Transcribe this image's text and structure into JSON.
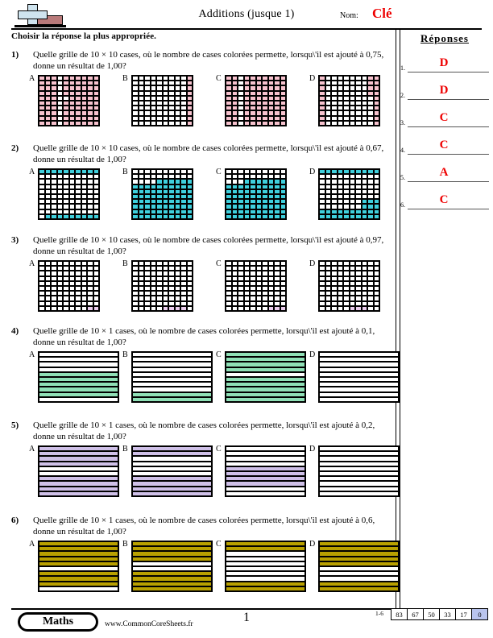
{
  "header": {
    "title": "Additions (jusque 1)",
    "name_label": "Nom:",
    "name_value": "Clé",
    "instruction": "Choisir la réponse la plus appropriée.",
    "logo_icon": "plus-block-logo"
  },
  "answers": {
    "title": "Réponses",
    "items": [
      {
        "num": "1.",
        "value": "D"
      },
      {
        "num": "2.",
        "value": "D"
      },
      {
        "num": "3.",
        "value": "C"
      },
      {
        "num": "4.",
        "value": "C"
      },
      {
        "num": "5.",
        "value": "A"
      },
      {
        "num": "6.",
        "value": "C"
      }
    ]
  },
  "questions": [
    {
      "num": "1)",
      "text": "Quelle grille de 10 × 10 cases, où le nombre de cases colorées permette, lorsqu\\'il est ajouté à 0,75, donne un résultat de 1,00?",
      "grid_type": "10x10",
      "color": "#f7c2ce",
      "choices": [
        {
          "label": "A",
          "filled": 75
        },
        {
          "label": "B",
          "filled": 10
        },
        {
          "label": "C",
          "filled": 80
        },
        {
          "label": "D",
          "filled": 25
        }
      ]
    },
    {
      "num": "2)",
      "text": "Quelle grille de 10 × 10 cases, où le nombre de cases colorées permette, lorsqu\\'il est ajouté à 0,67, donne un résultat de 1,00?",
      "grid_type": "10x10",
      "color": "#3fd0dd",
      "choices": [
        {
          "label": "A",
          "filled": 21
        },
        {
          "label": "B",
          "filled": 65
        },
        {
          "label": "C",
          "filled": 73
        },
        {
          "label": "D",
          "filled": 33
        }
      ]
    },
    {
      "num": "3)",
      "text": "Quelle grille de 10 × 10 cases, où le nombre de cases colorées permette, lorsqu\\'il est ajouté à 0,97, donne un résultat de 1,00?",
      "grid_type": "10x10",
      "color": "#eccdef",
      "choices": [
        {
          "label": "A",
          "filled": 2
        },
        {
          "label": "B",
          "filled": 4
        },
        {
          "label": "C",
          "filled": 3
        },
        {
          "label": "D",
          "filled": 3
        }
      ]
    },
    {
      "num": "4)",
      "text": "Quelle grille de 10 × 1 cases, où le nombre de cases colorées permette, lorsqu\\'il est ajouté à 0,1, donne un résultat de 1,00?",
      "grid_type": "10x1",
      "color": "#8fe0b6",
      "choices": [
        {
          "label": "A",
          "filled": 5
        },
        {
          "label": "B",
          "filled": 2
        },
        {
          "label": "C",
          "filled": 9
        },
        {
          "label": "D",
          "filled": 0
        }
      ]
    },
    {
      "num": "5)",
      "text": "Quelle grille de 10 × 1 cases, où le nombre de cases colorées permette, lorsqu\\'il est ajouté à 0,2, donne un résultat de 1,00?",
      "grid_type": "10x1",
      "color": "#cfc0e8",
      "choices": [
        {
          "label": "A",
          "filled": 8
        },
        {
          "label": "B",
          "filled": 6
        },
        {
          "label": "C",
          "filled": 4
        },
        {
          "label": "D",
          "filled": 0
        }
      ]
    },
    {
      "num": "6)",
      "text": "Quelle grille de 10 × 1 cases, où le nombre de cases colorées permette, lorsqu\\'il est ajouté à 0,6, donne un résultat de 1,00?",
      "grid_type": "10x1",
      "color": "#b8a000",
      "choices": [
        {
          "label": "A",
          "filled": 7
        },
        {
          "label": "B",
          "filled": 8
        },
        {
          "label": "C",
          "filled": 4
        },
        {
          "label": "D",
          "filled": 6
        }
      ]
    }
  ],
  "fill_patterns": {
    "q1": {
      "A": [
        1,
        1,
        1,
        0,
        1,
        1,
        1,
        1,
        1,
        1,
        1,
        1,
        1,
        0,
        1,
        1,
        1,
        1,
        1,
        1,
        1,
        1,
        1,
        0,
        1,
        1,
        1,
        1,
        1,
        1,
        1,
        1,
        1,
        0,
        1,
        1,
        1,
        1,
        1,
        1,
        1,
        1,
        1,
        0,
        0,
        1,
        1,
        1,
        1,
        1,
        1,
        1,
        1,
        0,
        1,
        1,
        1,
        1,
        1,
        1,
        1,
        1,
        1,
        0,
        1,
        1,
        1,
        1,
        1,
        1,
        1,
        1,
        1,
        0,
        1,
        1,
        1,
        1,
        1,
        1,
        1,
        1,
        1,
        0,
        1,
        1,
        1,
        1,
        1,
        1,
        1,
        1,
        1,
        0,
        1,
        1,
        1,
        1,
        1,
        1
      ],
      "B": [
        0,
        0,
        0,
        0,
        0,
        0,
        0,
        0,
        0,
        1,
        0,
        0,
        0,
        0,
        0,
        0,
        0,
        0,
        0,
        1,
        0,
        0,
        0,
        0,
        0,
        0,
        0,
        0,
        0,
        1,
        0,
        0,
        0,
        0,
        0,
        0,
        0,
        0,
        0,
        1,
        0,
        0,
        0,
        0,
        0,
        0,
        0,
        0,
        0,
        1,
        0,
        0,
        0,
        0,
        0,
        0,
        0,
        0,
        0,
        1,
        0,
        0,
        0,
        0,
        0,
        0,
        0,
        0,
        0,
        1,
        0,
        0,
        0,
        0,
        0,
        0,
        0,
        0,
        0,
        1,
        0,
        0,
        0,
        0,
        0,
        0,
        0,
        0,
        0,
        1,
        0,
        0,
        0,
        0,
        0,
        0,
        0,
        0,
        0,
        1
      ],
      "C": [
        1,
        1,
        0,
        1,
        1,
        1,
        1,
        1,
        1,
        1,
        1,
        1,
        0,
        1,
        1,
        1,
        1,
        1,
        1,
        1,
        1,
        1,
        0,
        1,
        1,
        1,
        1,
        1,
        1,
        1,
        1,
        1,
        0,
        1,
        1,
        1,
        1,
        1,
        1,
        1,
        1,
        1,
        0,
        1,
        1,
        1,
        1,
        1,
        1,
        1,
        1,
        1,
        0,
        1,
        1,
        1,
        1,
        1,
        1,
        1,
        1,
        1,
        0,
        1,
        1,
        1,
        1,
        1,
        1,
        1,
        1,
        1,
        0,
        1,
        1,
        1,
        1,
        1,
        1,
        1,
        1,
        1,
        0,
        1,
        1,
        1,
        1,
        1,
        1,
        1,
        1,
        1,
        0,
        1,
        1,
        1,
        1,
        1,
        1,
        1
      ],
      "D": [
        1,
        0,
        0,
        0,
        0,
        0,
        0,
        0,
        1,
        1,
        1,
        0,
        0,
        0,
        0,
        0,
        0,
        0,
        1,
        1,
        1,
        0,
        0,
        0,
        0,
        0,
        0,
        0,
        1,
        1,
        1,
        0,
        0,
        0,
        0,
        0,
        0,
        0,
        1,
        1,
        1,
        0,
        0,
        0,
        0,
        0,
        0,
        0,
        0,
        1,
        1,
        0,
        0,
        0,
        0,
        0,
        0,
        0,
        0,
        1,
        1,
        0,
        0,
        0,
        0,
        0,
        0,
        0,
        0,
        1,
        1,
        0,
        0,
        0,
        0,
        0,
        0,
        0,
        0,
        1,
        1,
        0,
        0,
        0,
        0,
        0,
        0,
        0,
        0,
        1,
        1,
        0,
        0,
        0,
        0,
        0,
        0,
        0,
        0,
        1
      ]
    },
    "q2": {
      "A": [
        1,
        1,
        1,
        1,
        1,
        1,
        1,
        1,
        1,
        1,
        0,
        0,
        0,
        0,
        0,
        0,
        0,
        0,
        0,
        0,
        0,
        0,
        0,
        0,
        0,
        0,
        0,
        0,
        0,
        0,
        0,
        0,
        0,
        0,
        0,
        0,
        0,
        0,
        0,
        0,
        0,
        0,
        0,
        0,
        0,
        0,
        0,
        0,
        0,
        0,
        0,
        0,
        0,
        0,
        0,
        0,
        0,
        0,
        0,
        0,
        0,
        0,
        0,
        0,
        0,
        0,
        0,
        0,
        0,
        0,
        0,
        0,
        0,
        0,
        0,
        0,
        0,
        0,
        0,
        0,
        0,
        0,
        0,
        0,
        0,
        0,
        0,
        0,
        0,
        0,
        0,
        1,
        1,
        1,
        1,
        1,
        1,
        1,
        1,
        1
      ],
      "B": [
        0,
        0,
        0,
        0,
        0,
        0,
        0,
        0,
        0,
        0,
        0,
        0,
        0,
        0,
        0,
        0,
        0,
        0,
        0,
        0,
        0,
        0,
        0,
        0,
        1,
        1,
        1,
        1,
        1,
        1,
        1,
        1,
        1,
        1,
        1,
        1,
        1,
        1,
        1,
        1,
        1,
        1,
        1,
        1,
        1,
        1,
        1,
        1,
        1,
        1,
        1,
        1,
        1,
        1,
        1,
        1,
        1,
        1,
        1,
        1,
        1,
        1,
        1,
        1,
        1,
        1,
        1,
        1,
        1,
        1,
        1,
        1,
        1,
        1,
        1,
        1,
        1,
        1,
        1,
        1,
        1,
        1,
        1,
        1,
        1,
        1,
        1,
        1,
        1,
        1,
        1,
        1,
        1,
        1,
        1,
        1,
        1,
        1,
        1,
        1
      ],
      "C": [
        0,
        0,
        0,
        0,
        0,
        0,
        0,
        0,
        0,
        0,
        0,
        0,
        0,
        0,
        0,
        0,
        0,
        0,
        0,
        0,
        0,
        0,
        0,
        1,
        1,
        1,
        1,
        1,
        1,
        1,
        1,
        1,
        1,
        1,
        1,
        1,
        1,
        1,
        1,
        1,
        1,
        1,
        1,
        1,
        1,
        1,
        1,
        1,
        1,
        1,
        1,
        1,
        1,
        1,
        1,
        1,
        1,
        1,
        1,
        1,
        1,
        1,
        1,
        1,
        1,
        1,
        1,
        1,
        1,
        1,
        1,
        1,
        1,
        1,
        1,
        1,
        1,
        1,
        1,
        1,
        1,
        1,
        1,
        1,
        1,
        1,
        1,
        1,
        1,
        1,
        1,
        1,
        1,
        1,
        1,
        1,
        1,
        1,
        1,
        1
      ],
      "D": [
        1,
        1,
        1,
        1,
        1,
        1,
        1,
        1,
        1,
        1,
        0,
        0,
        0,
        0,
        0,
        0,
        0,
        0,
        0,
        0,
        0,
        0,
        0,
        0,
        0,
        0,
        0,
        0,
        0,
        0,
        0,
        0,
        0,
        0,
        0,
        0,
        0,
        0,
        0,
        0,
        0,
        0,
        0,
        0,
        0,
        0,
        0,
        0,
        0,
        0,
        0,
        0,
        0,
        0,
        0,
        0,
        0,
        0,
        0,
        0,
        0,
        0,
        0,
        0,
        0,
        0,
        0,
        1,
        1,
        1,
        0,
        0,
        0,
        0,
        0,
        0,
        0,
        1,
        1,
        1,
        1,
        1,
        1,
        1,
        1,
        1,
        1,
        1,
        1,
        1,
        1,
        1,
        1,
        1,
        1,
        1,
        1,
        1,
        1,
        1
      ]
    },
    "q3": {
      "A": [
        0,
        0,
        0,
        0,
        0,
        0,
        0,
        0,
        0,
        0,
        0,
        0,
        0,
        0,
        0,
        0,
        0,
        0,
        0,
        0,
        0,
        0,
        0,
        0,
        0,
        0,
        0,
        0,
        0,
        0,
        0,
        0,
        0,
        0,
        0,
        0,
        0,
        0,
        0,
        0,
        0,
        0,
        0,
        0,
        0,
        0,
        0,
        0,
        0,
        0,
        0,
        0,
        0,
        0,
        0,
        0,
        0,
        0,
        0,
        0,
        0,
        0,
        0,
        0,
        0,
        0,
        0,
        0,
        0,
        0,
        0,
        0,
        0,
        0,
        0,
        0,
        0,
        0,
        0,
        0,
        0,
        0,
        0,
        0,
        0,
        0,
        0,
        0,
        0,
        0,
        0,
        0,
        0,
        0,
        0,
        0,
        0,
        0,
        1,
        1
      ],
      "B": [
        0,
        0,
        0,
        0,
        0,
        0,
        0,
        0,
        0,
        0,
        0,
        0,
        0,
        0,
        0,
        0,
        0,
        0,
        0,
        0,
        0,
        0,
        0,
        0,
        0,
        0,
        0,
        0,
        0,
        0,
        0,
        0,
        0,
        0,
        0,
        0,
        0,
        0,
        0,
        0,
        0,
        0,
        0,
        0,
        0,
        0,
        0,
        0,
        0,
        0,
        0,
        0,
        0,
        0,
        0,
        0,
        0,
        0,
        0,
        0,
        0,
        0,
        0,
        0,
        0,
        0,
        0,
        0,
        0,
        0,
        0,
        0,
        0,
        0,
        0,
        0,
        0,
        0,
        0,
        0,
        0,
        0,
        0,
        0,
        0,
        0,
        0,
        0,
        0,
        0,
        0,
        0,
        0,
        0,
        0,
        1,
        1,
        1,
        1,
        0
      ],
      "C": [
        0,
        0,
        0,
        0,
        0,
        0,
        0,
        0,
        0,
        0,
        0,
        0,
        0,
        0,
        0,
        0,
        0,
        0,
        0,
        0,
        0,
        0,
        0,
        0,
        0,
        0,
        0,
        0,
        0,
        0,
        0,
        0,
        0,
        0,
        0,
        0,
        0,
        0,
        0,
        0,
        0,
        0,
        0,
        0,
        0,
        0,
        0,
        0,
        0,
        0,
        0,
        0,
        0,
        0,
        0,
        0,
        0,
        0,
        0,
        0,
        0,
        0,
        0,
        0,
        0,
        0,
        0,
        0,
        0,
        0,
        0,
        0,
        0,
        0,
        0,
        0,
        0,
        0,
        0,
        0,
        0,
        0,
        0,
        0,
        0,
        0,
        0,
        0,
        0,
        0,
        0,
        0,
        0,
        0,
        0,
        0,
        0,
        1,
        1,
        1
      ],
      "D": [
        0,
        0,
        0,
        0,
        0,
        0,
        0,
        0,
        0,
        0,
        0,
        0,
        0,
        0,
        0,
        0,
        0,
        0,
        0,
        0,
        0,
        0,
        0,
        0,
        0,
        0,
        0,
        0,
        0,
        0,
        0,
        0,
        0,
        0,
        0,
        0,
        0,
        0,
        0,
        0,
        0,
        0,
        0,
        0,
        0,
        0,
        0,
        0,
        0,
        0,
        0,
        0,
        0,
        0,
        0,
        0,
        0,
        0,
        0,
        0,
        0,
        0,
        0,
        0,
        0,
        0,
        0,
        0,
        0,
        0,
        0,
        0,
        0,
        0,
        0,
        0,
        0,
        0,
        0,
        0,
        0,
        0,
        0,
        0,
        0,
        0,
        0,
        0,
        0,
        0,
        0,
        0,
        0,
        0,
        0,
        1,
        1,
        1,
        0,
        0
      ]
    },
    "q4": {
      "A": [
        0,
        0,
        0,
        0,
        1,
        1,
        1,
        1,
        1,
        0
      ],
      "B": [
        0,
        0,
        0,
        0,
        0,
        0,
        0,
        0,
        1,
        1
      ],
      "C": [
        1,
        1,
        1,
        1,
        0,
        1,
        1,
        1,
        1,
        1
      ],
      "D": [
        0,
        0,
        0,
        0,
        0,
        0,
        0,
        0,
        0,
        0
      ]
    },
    "q5": {
      "A": [
        1,
        1,
        1,
        1,
        0,
        0,
        1,
        1,
        1,
        1
      ],
      "B": [
        1,
        1,
        0,
        0,
        0,
        0,
        1,
        1,
        1,
        1
      ],
      "C": [
        0,
        0,
        0,
        0,
        1,
        1,
        1,
        1,
        0,
        0
      ],
      "D": [
        0,
        0,
        0,
        0,
        0,
        0,
        0,
        0,
        0,
        0
      ]
    },
    "q6": {
      "A": [
        1,
        1,
        1,
        1,
        1,
        0,
        1,
        1,
        1,
        0
      ],
      "B": [
        1,
        1,
        1,
        1,
        0,
        0,
        1,
        1,
        1,
        1
      ],
      "C": [
        1,
        1,
        0,
        0,
        0,
        0,
        0,
        0,
        1,
        1
      ],
      "D": [
        1,
        1,
        1,
        1,
        1,
        0,
        0,
        0,
        1,
        1
      ]
    }
  },
  "footer": {
    "subject": "Maths",
    "site": "www.CommonCoreSheets.fr",
    "page_number": "1",
    "score_label": "1-6",
    "scores": [
      "83",
      "67",
      "50",
      "33",
      "17",
      "0"
    ]
  }
}
